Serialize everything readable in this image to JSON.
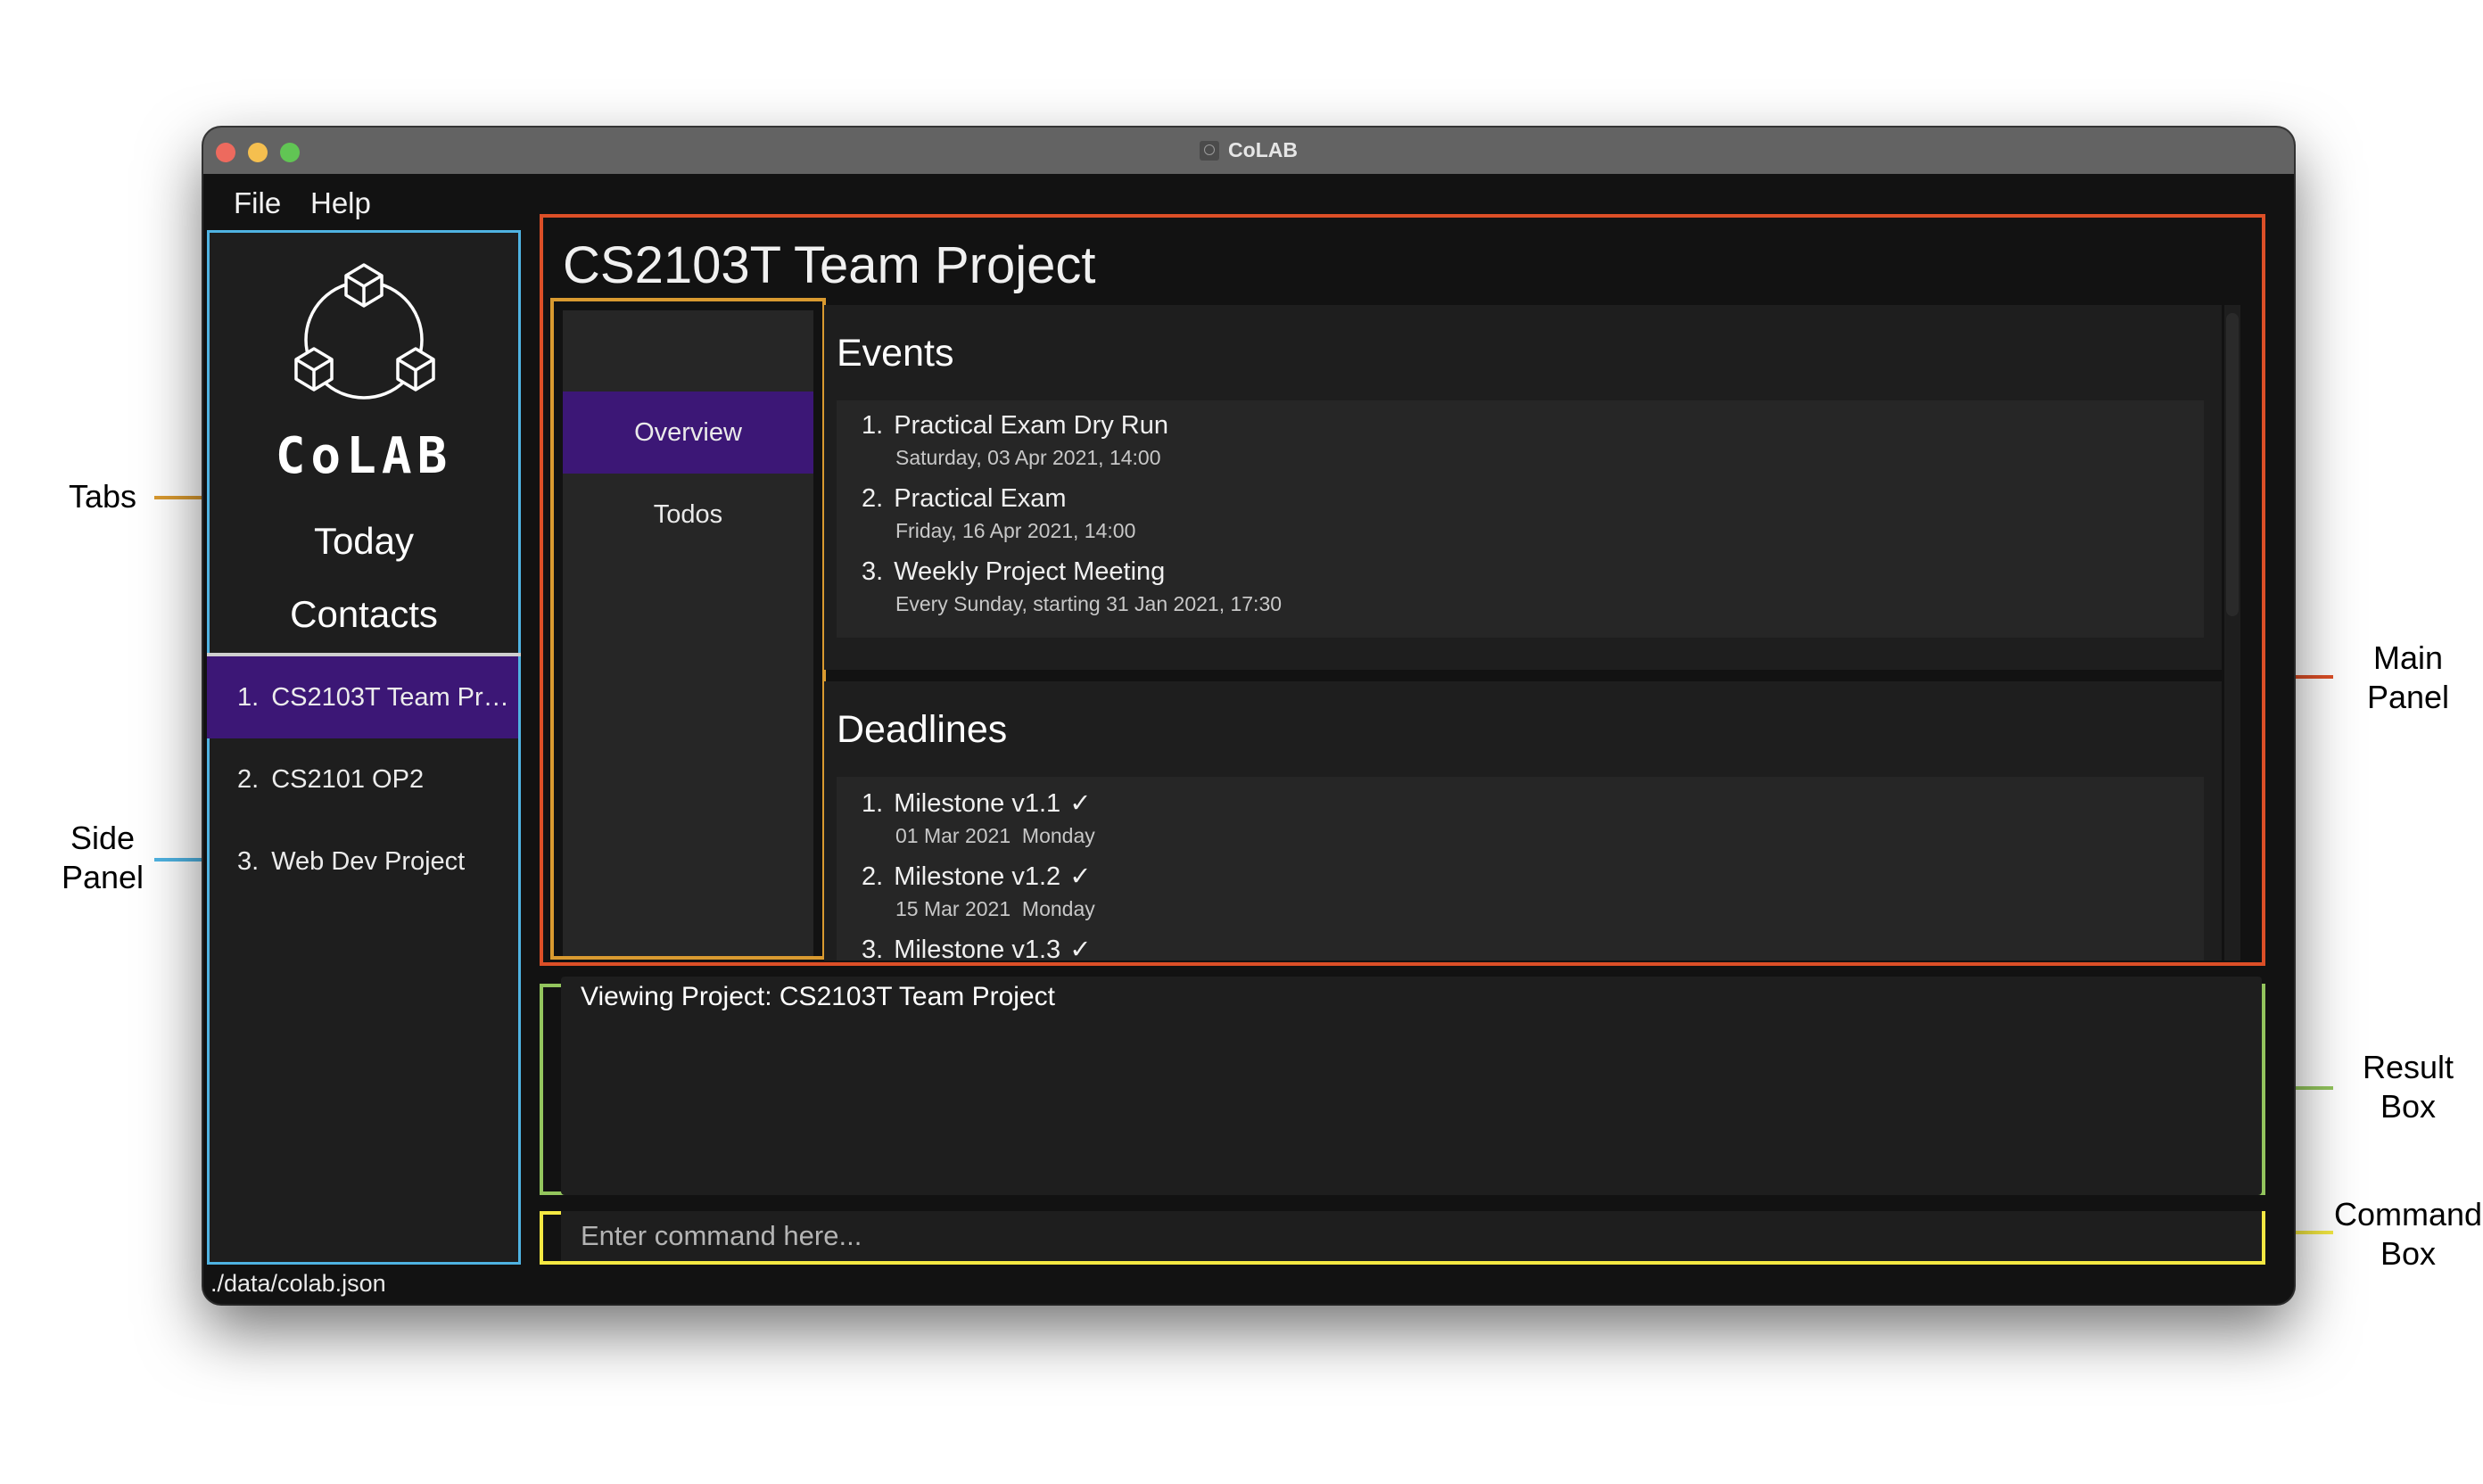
{
  "window": {
    "title": "CoLAB",
    "menu": [
      "File",
      "Help"
    ]
  },
  "side_panel": {
    "logo_text": "CoLAB",
    "nav": [
      "Today",
      "Contacts"
    ],
    "projects": [
      {
        "number": "1.",
        "name": "CS2103T Team Proj...",
        "selected": true
      },
      {
        "number": "2.",
        "name": "CS2101 OP2",
        "selected": false
      },
      {
        "number": "3.",
        "name": "Web Dev Project",
        "selected": false
      }
    ]
  },
  "main_panel": {
    "project_title": "CS2103T Team Project",
    "tabs": [
      {
        "label": "Overview",
        "active": true
      },
      {
        "label": "Todos",
        "active": false
      }
    ],
    "events": {
      "title": "Events",
      "items": [
        {
          "number": "1.",
          "name": "Practical Exam Dry Run",
          "detail": "Saturday, 03 Apr 2021, 14:00"
        },
        {
          "number": "2.",
          "name": "Practical Exam",
          "detail": "Friday, 16 Apr 2021, 14:00"
        },
        {
          "number": "3.",
          "name": "Weekly Project Meeting",
          "detail": "Every Sunday, starting 31 Jan 2021, 17:30"
        }
      ]
    },
    "deadlines": {
      "title": "Deadlines",
      "items": [
        {
          "number": "1.",
          "name": "Milestone v1.1",
          "done_mark": "✓",
          "detail": "01 Mar 2021  Monday"
        },
        {
          "number": "2.",
          "name": "Milestone v1.2",
          "done_mark": "✓",
          "detail": "15 Mar 2021  Monday"
        },
        {
          "number": "3.",
          "name": "Milestone v1.3",
          "done_mark": "✓",
          "detail": ""
        }
      ]
    }
  },
  "result_box": {
    "text": "Viewing Project: CS2103T Team Project"
  },
  "command_box": {
    "value": "",
    "placeholder": "Enter command here..."
  },
  "status_bar": {
    "path": "./data/colab.json"
  },
  "annotations": {
    "tabs": "Tabs",
    "side_panel": [
      "Side",
      "Panel"
    ],
    "main_panel": [
      "Main",
      "Panel"
    ],
    "result_box": [
      "Result",
      "Box"
    ],
    "command_box": [
      "Command",
      "Box"
    ]
  },
  "colors": {
    "accent_selected": "#3c1776",
    "main_panel_outline": "#dc4f27",
    "tabs_outline": "#d99a30",
    "side_panel_outline": "#4fb3e2",
    "result_box_outline": "#93c55d",
    "command_box_outline": "#f4e842"
  }
}
